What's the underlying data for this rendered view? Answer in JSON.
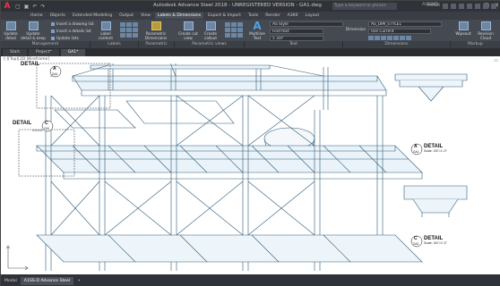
{
  "window": {
    "title": "Autodesk Advance Steel 2018 - UNREGISTERED VERSION - GA1.dwg",
    "search_placeholder": "Type a keyword or phrase",
    "user": "ASG001"
  },
  "menu": [
    "Home",
    "Objects",
    "Extended Modeling",
    "Output",
    "View",
    "Labels & Dimensions",
    "Export & Import",
    "Tools",
    "Render",
    "A360",
    "Layout"
  ],
  "menu_active_index": 5,
  "ribbon": {
    "update_detail": "Update detail",
    "update_detail_keep": "Update detail & keep revision",
    "insert_drawing_list": "Insert a drawing list",
    "insert_details_list": "Insert a details list",
    "update_lists": "Update lists",
    "label_content_manager": "Label content manager",
    "parametric_dimensions": "Parametric Dimensions",
    "create_cut_view": "Create cut view",
    "create_callout_view": "Create callout view",
    "multiline_text": "Multiline Text",
    "text_style": "AS Style",
    "text_field_2": "Find text",
    "text_height": "5 3/4\"",
    "dim_style": "AS_DIM_STYLE1",
    "dim_layer": "Use Current",
    "dimension": "Dimension",
    "wipeout": "Wipeout",
    "revision_cloud": "Revision Cloud"
  },
  "panel_titles": [
    "Management",
    "Labels",
    "Parametric Dimensions",
    "Parametric views",
    "Text",
    "Dimensions",
    "Markup"
  ],
  "doc_tabs": [
    {
      "label": "Start",
      "active": false
    },
    {
      "label": "Project*",
      "active": false
    },
    {
      "label": "GA1*",
      "active": true
    }
  ],
  "viewport_label": "[-][Top][2D Wireframe]",
  "details": {
    "left_a": {
      "title": "DETAIL",
      "letter": "A",
      "sheet": "GA1"
    },
    "left_c": {
      "title": "DETAIL",
      "letter": "C",
      "sheet": "GA1"
    },
    "right_a": {
      "title": "DETAIL",
      "letter": "A",
      "sheet": "GA1",
      "scale": "Scale: 3/4\"=1'-0\""
    },
    "right_c": {
      "title": "DETAIL",
      "letter": "C",
      "sheet": "GA1",
      "scale": "Scale: 3/4\"=1'-0\""
    }
  },
  "status_tabs": [
    {
      "label": "Model",
      "active": false
    },
    {
      "label": "A1SS-D Advance Steel",
      "active": true
    },
    {
      "label": "+",
      "active": false
    }
  ],
  "status_right": {
    "paper": "PAPER"
  }
}
